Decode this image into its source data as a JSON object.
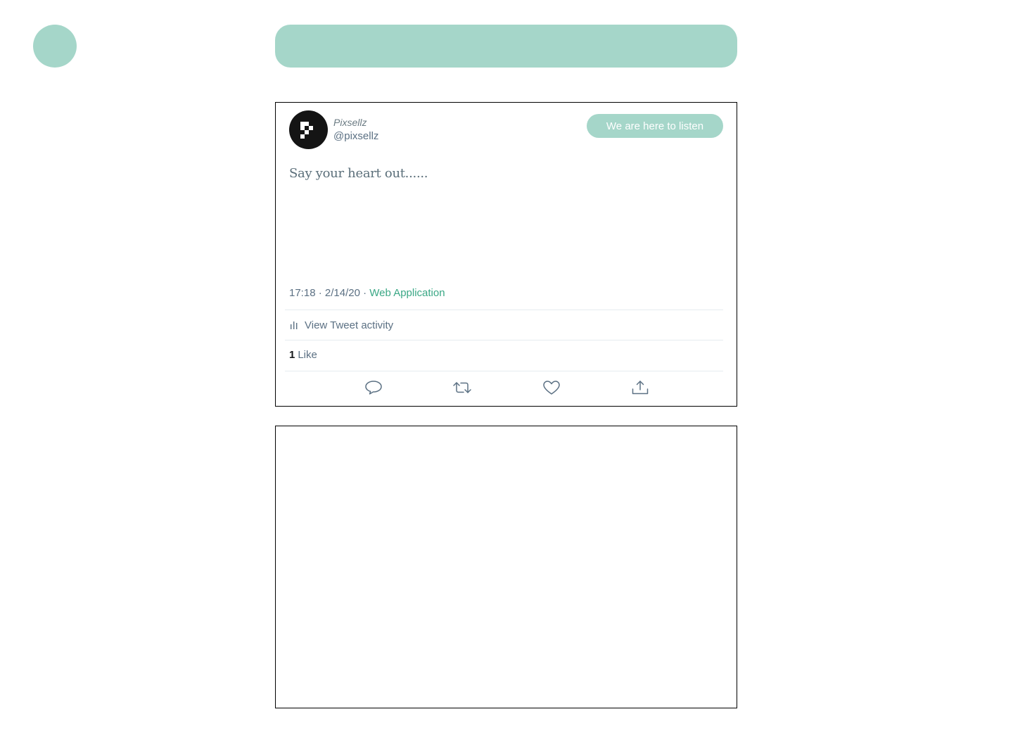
{
  "theme": {
    "accent": "#a5d6c9",
    "link": "#3aa785",
    "icon": "#5b7083"
  },
  "profile": {
    "display_name": "Pixsellz",
    "handle": "@pixsellz",
    "avatar_icon": "pixsellz-logo-icon"
  },
  "header": {
    "listen_button_label": "We are here to listen"
  },
  "tweet": {
    "text": "Say your heart out......",
    "time": "17:18",
    "date": "2/14/20",
    "separator": "·",
    "source": "Web Application",
    "activity_label": "View Tweet activity",
    "activity_icon": "bar-chart-icon",
    "like_count": "1",
    "like_label": "Like"
  },
  "actions": [
    {
      "name": "reply",
      "icon": "reply-icon"
    },
    {
      "name": "retweet",
      "icon": "retweet-icon"
    },
    {
      "name": "like",
      "icon": "heart-icon"
    },
    {
      "name": "share",
      "icon": "share-icon"
    }
  ]
}
